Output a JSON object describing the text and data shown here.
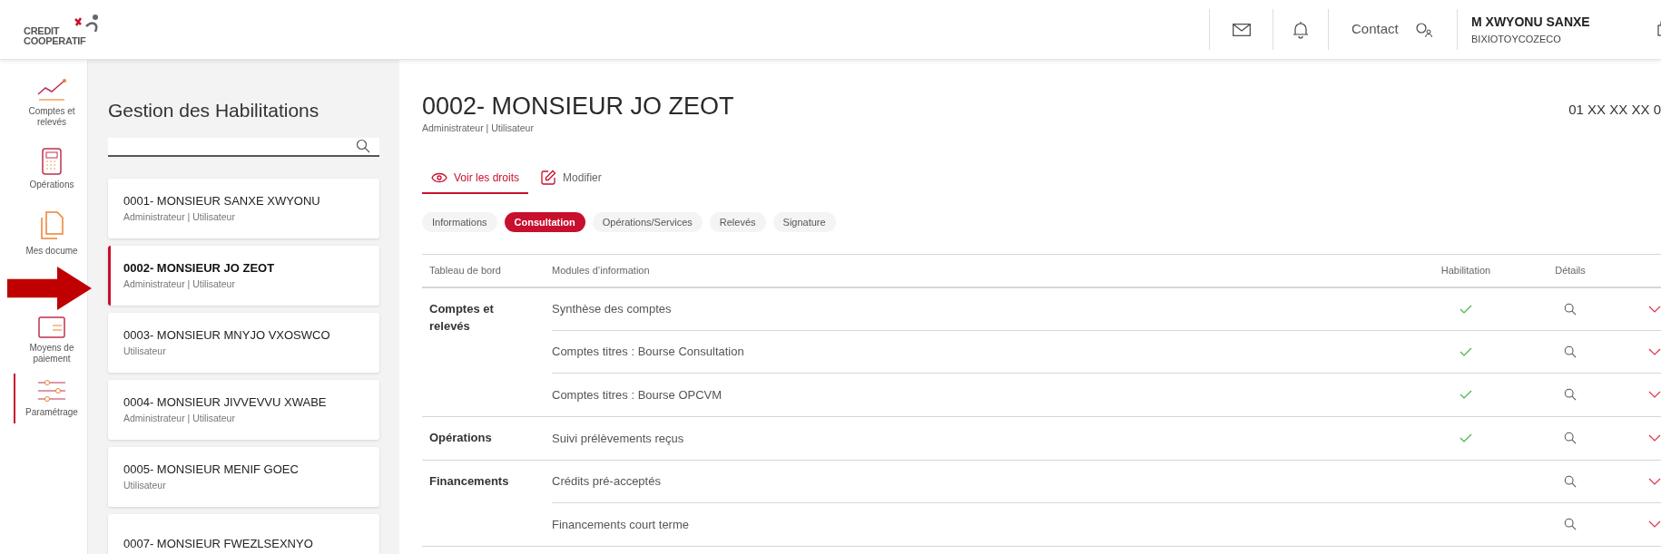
{
  "header": {
    "logo": {
      "line1": "CREDIT",
      "line2": "COOPERATIF"
    },
    "contact": "Contact",
    "user": {
      "name": "M XWYONU SANXE",
      "company": "BIXIOTOYCOZECO"
    }
  },
  "nav": [
    {
      "kind": "chart",
      "label": "Comptes et relevés",
      "selected": false
    },
    {
      "kind": "calculator",
      "label": "Opérations",
      "selected": false
    },
    {
      "kind": "documents",
      "label": "Mes docume",
      "selected": false
    },
    {
      "kind": "payment",
      "label": "Moyens de paiement",
      "selected": false
    },
    {
      "kind": "settings",
      "label": "Paramétrage",
      "selected": true
    }
  ],
  "panel": {
    "title": "Gestion des Habilitations",
    "users": [
      {
        "name": "0001- MONSIEUR SANXE XWYONU",
        "roles": "Administrateur | Utilisateur",
        "selected": false
      },
      {
        "name": "0002- MONSIEUR JO ZEOT",
        "roles": "Administrateur | Utilisateur",
        "selected": true
      },
      {
        "name": "0003- MONSIEUR MNYJO VXOSWCO",
        "roles": "Utilisateur",
        "selected": false
      },
      {
        "name": "0004- MONSIEUR JIVVEVVU XWABE",
        "roles": "Administrateur | Utilisateur",
        "selected": false
      },
      {
        "name": "0005- MONSIEUR MENIF GOEC",
        "roles": "Utilisateur",
        "selected": false
      },
      {
        "name": "0007- MONSIEUR FWEZLSEXNYO",
        "selected": false
      }
    ]
  },
  "detail": {
    "title": "0002- MONSIEUR JO ZEOT",
    "subtitle": "Administrateur | Utilisateur",
    "phone": "01 XX XX XX 0",
    "mode_tabs": [
      {
        "kind": "view",
        "label": "Voir les droits",
        "selected": true
      },
      {
        "kind": "edit",
        "label": "Modifier",
        "selected": false
      }
    ],
    "pills": [
      {
        "label": "Informations",
        "selected": false
      },
      {
        "label": "Consultation",
        "selected": true
      },
      {
        "label": "Opérations/Services",
        "selected": false
      },
      {
        "label": "Relevés",
        "selected": false
      },
      {
        "label": "Signature",
        "selected": false
      }
    ],
    "table": {
      "columns": [
        "Tableau de bord",
        "Modules d’information",
        "Habilitation",
        "Détails"
      ],
      "groups": [
        {
          "label": "Comptes et relevés",
          "rows": [
            {
              "module": "Synthèse des comptes",
              "enabled": true
            },
            {
              "module": "Comptes titres : Bourse Consultation",
              "enabled": true
            },
            {
              "module": "Comptes titres : Bourse OPCVM",
              "enabled": true
            }
          ]
        },
        {
          "label": "Opérations",
          "rows": [
            {
              "module": "Suivi prélèvements reçus",
              "enabled": true
            }
          ]
        },
        {
          "label": "Financements",
          "rows": [
            {
              "module": "Crédits pré-acceptés",
              "enabled": false
            },
            {
              "module": "Financements court terme",
              "enabled": false
            }
          ]
        }
      ]
    }
  }
}
